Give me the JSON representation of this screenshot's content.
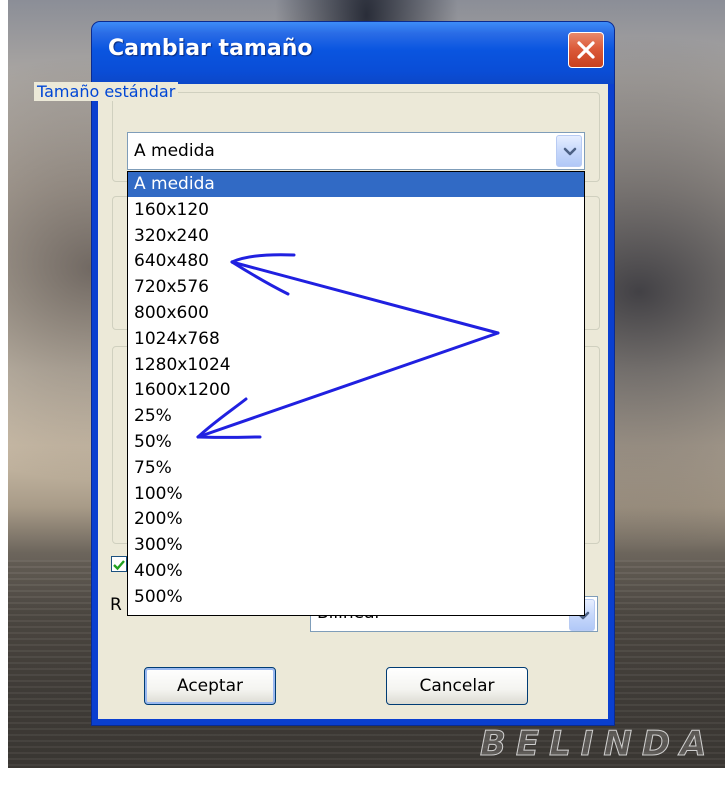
{
  "dialog": {
    "title": "Cambiar tamaño",
    "standard_size_group": "Tamaño estándar",
    "selected_size": "A medida",
    "size_options": [
      "A medida",
      "160x120",
      "320x240",
      "640x480",
      "720x576",
      "800x600",
      "1024x768",
      "1280x1024",
      "1600x1200",
      "25%",
      "50%",
      "75%",
      "100%",
      "200%",
      "300%",
      "400%",
      "500%"
    ],
    "highlighted_option": "A medida",
    "resample_label_partial": "R",
    "resample_combo_partial": "Bilinear",
    "ok_label": "Aceptar",
    "cancel_label": "Cancelar"
  },
  "desktop": {
    "watermark": "BELINDA"
  },
  "colors": {
    "titlebar": "#0a55e0",
    "selection": "#316ac5",
    "annotation_arrows": "#2020e0",
    "dialog_face": "#ece9d8"
  },
  "icons": [
    "close-icon",
    "chevron-down-icon",
    "checkmark-icon"
  ]
}
